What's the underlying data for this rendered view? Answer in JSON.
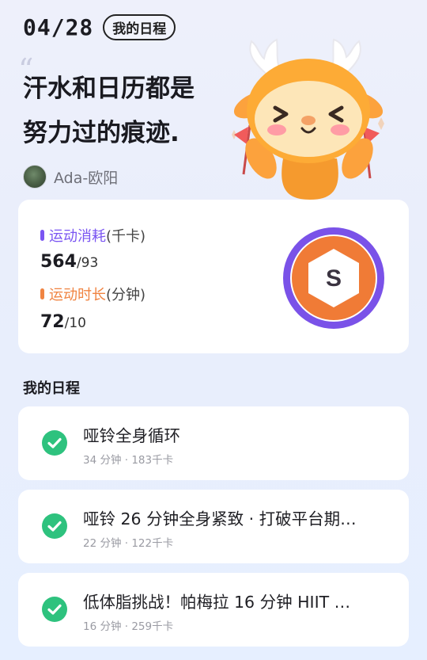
{
  "header": {
    "date": "04/28",
    "tag": "我的日程",
    "quote_mark": "“",
    "slogan_line1": "汗水和日历都是",
    "slogan_line2": "努力过的痕迹."
  },
  "user": {
    "name": "Ada-欧阳"
  },
  "stats": {
    "calories": {
      "label_color": "运动消耗",
      "label_unit": "(千卡)",
      "value": "564",
      "sub": "/93",
      "color": "#7a55f2"
    },
    "duration": {
      "label_color": "运动时长",
      "label_unit": "(分钟)",
      "value": "72",
      "sub": "/10",
      "color": "#f08442"
    },
    "badge_letter": "S"
  },
  "schedule": {
    "title": "我的日程",
    "items": [
      {
        "title": "哑铃全身循环",
        "meta": "34 分钟 · 183千卡"
      },
      {
        "title": "哑铃 26 分钟全身紧致 · 打破平台期…",
        "meta": "22 分钟 · 122千卡"
      },
      {
        "title": "低体脂挑战！帕梅拉 16 分钟 HIIT …",
        "meta": "16 分钟 · 259千卡"
      }
    ]
  },
  "colors": {
    "accent_purple": "#7a55f2",
    "accent_orange": "#f08442",
    "check_green": "#2ec27e"
  }
}
